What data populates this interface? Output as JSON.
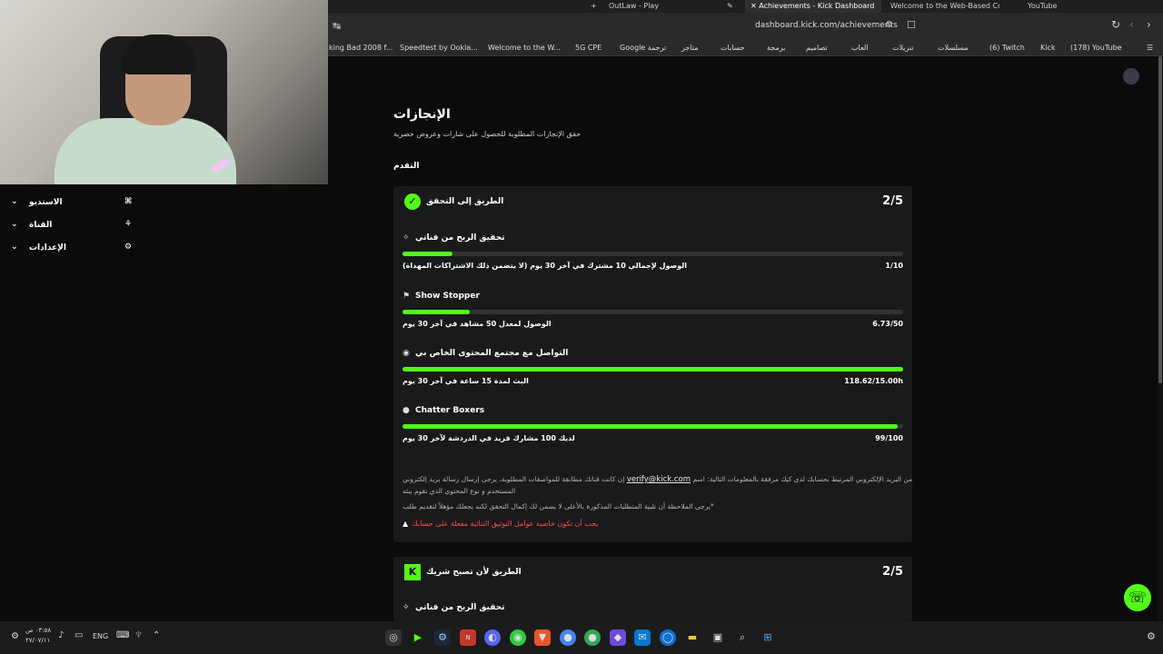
{
  "browser": {
    "tabs": [
      {
        "label": "OutLaw - Play"
      },
      {
        "label": "Achievements - Kick Dashboard"
      },
      {
        "label": "Welcome to the Web-Based Confi"
      },
      {
        "label": "YouTube"
      }
    ],
    "url": "dashboard.kick.com/achievements",
    "bookmarks": [
      "king Bad 2008 f...",
      "Speedtest by Ookla...",
      "Welcome to the W...",
      "5G CPE",
      "Google ترجمة",
      "متاجر",
      "حسابات",
      "برمجة",
      "تصاميم",
      "العاب",
      "تنزيلات",
      "مسلسلات",
      "(6) Twitch",
      "Kick",
      "(178) YouTube"
    ]
  },
  "sidebar": {
    "items": [
      {
        "label": "الاستديو"
      },
      {
        "label": "القناة"
      },
      {
        "label": "الإعدادات"
      }
    ]
  },
  "main": {
    "title": "الإنجازات",
    "subtitle": "حقق الإنجازات المطلوبة للحصول على شارات وعروض حصرية",
    "section": "التقدم"
  },
  "card1": {
    "title": "الطريق إلى التحقق",
    "score": "2/5",
    "requirements": [
      {
        "title": "تحقيق الربح من قناتي",
        "desc": "الوصول لإجمالي 10 مشترك في آخر 30 يوم (لا يتضمن ذلك الاشتراكات المهداة)",
        "value": "1/10",
        "progress": 0.1
      },
      {
        "title": "Show Stopper",
        "desc": "الوصول لمعدل 50 مشاهد في آخر 30 يوم",
        "value": "6.73/50",
        "progress": 0.135
      },
      {
        "title": "التواصل مع مجتمع المحتوى الخاص بي",
        "desc": "البث لمدة 15 ساعة في آخر 30 يوم",
        "value": "118.62/15.00h",
        "progress": 1
      },
      {
        "title": "Chatter Boxers",
        "desc": "لديك 100 مشارك فريد في الدردشة لآخر 30 يوم",
        "value": "99/100",
        "progress": 0.99
      }
    ],
    "note1_pre": "إن كانت قناتك مطابقة للمواصفات المطلوبة، يرجى إرسال رسالة بريد إلكتروني",
    "email": "verify@kick.com",
    "note1_post": "من البريد الإلكتروني المرتبط بحسابك لدى كيك مرفقة بالمعلومات التالية: اسم",
    "note1_line2": "المستخدم و نوع المحتوى الذي تقوم ببثه",
    "note2": "يرجى الملاحظة أن تلبية المتطلبات المذكورة بالأعلى لا يضمن لك إكمال التحقق لكنه يجعلك مؤهلاً لتقديم طلب*",
    "warning": "يجب أن تكون خاصية عوامل التوثيق الثنائية مفعلة على حسابك"
  },
  "card2": {
    "title": "الطريق لأن تصبح شريك",
    "score": "2/5",
    "first_req": "تحقيق الربح من قناتي"
  },
  "taskbar": {
    "time": "٠٣:٥٨ ص",
    "date": "٢٧/٠٧/١١",
    "lang": "ENG"
  },
  "colors": {
    "accent": "#53fc18",
    "bg": "#0b0b0b",
    "card": "#191a1b",
    "warning": "#ff4d4d"
  }
}
